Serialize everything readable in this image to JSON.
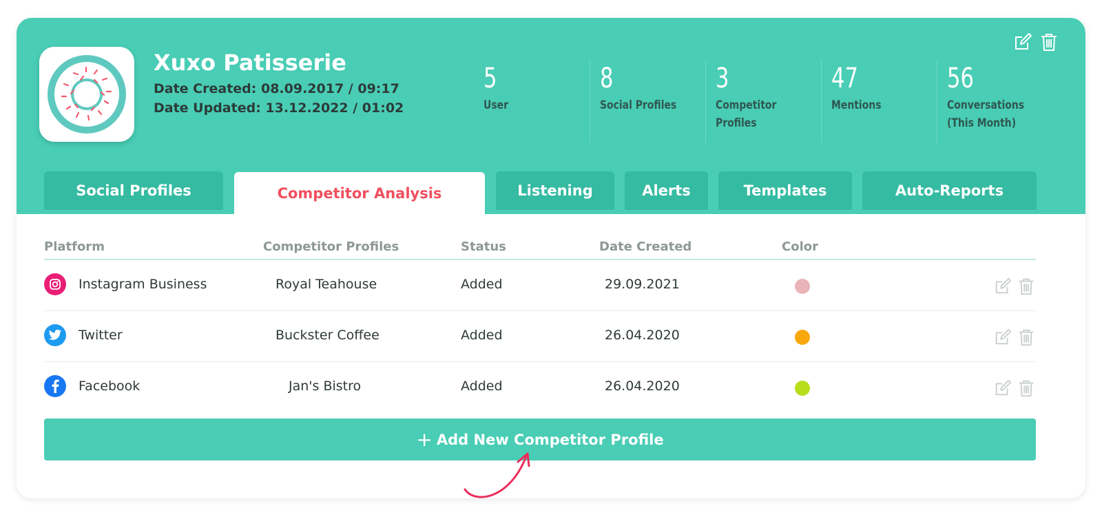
{
  "colors": {
    "accent": "#49cdb5",
    "tab_bg": "#35bba2",
    "active_tab_text": "#f0505f",
    "arrow": "#ec2d5b"
  },
  "account": {
    "name": "Xuxo Patisserie",
    "date_created": "Date Created: 08.09.2017 / 09:17",
    "date_updated": "Date Updated: 13.12.2022 / 01:02",
    "logo_icon": "donut-icon"
  },
  "header_actions": {
    "edit_icon": "edit-icon",
    "delete_icon": "trash-icon"
  },
  "stats": [
    {
      "value": "5",
      "label": "User"
    },
    {
      "value": "8",
      "label": "Social Profiles"
    },
    {
      "value": "3",
      "label": "Competitor Profiles"
    },
    {
      "value": "47",
      "label": "Mentions"
    },
    {
      "value": "56",
      "label": "Conversations (This Month)"
    }
  ],
  "tabs": [
    {
      "label": "Social Profiles",
      "active": false
    },
    {
      "label": "Competitor Analysis",
      "active": true
    },
    {
      "label": "Listening",
      "active": false
    },
    {
      "label": "Alerts",
      "active": false
    },
    {
      "label": "Templates",
      "active": false
    },
    {
      "label": "Auto-Reports",
      "active": false
    }
  ],
  "table": {
    "columns": [
      "Platform",
      "Competitor Profiles",
      "Status",
      "Date Created",
      "Color"
    ],
    "rows": [
      {
        "platform": "Instagram Business",
        "platform_icon": "instagram-icon",
        "platform_color": "#e91e74",
        "competitor": "Royal Teahouse",
        "status": "Added",
        "date": "29.09.2021",
        "color": "#e8b4b8"
      },
      {
        "platform": "Twitter",
        "platform_icon": "twitter-icon",
        "platform_color": "#1d9bf0",
        "competitor": "Buckster Coffee",
        "status": "Added",
        "date": "26.04.2020",
        "color": "#f9a80c"
      },
      {
        "platform": "Facebook",
        "platform_icon": "facebook-icon",
        "platform_color": "#1877f2",
        "competitor": "Jan's Bistro",
        "status": "Added",
        "date": "26.04.2020",
        "color": "#b7de1a"
      }
    ]
  },
  "add_button": {
    "icon": "plus-icon",
    "label": "Add New Competitor Profile"
  }
}
